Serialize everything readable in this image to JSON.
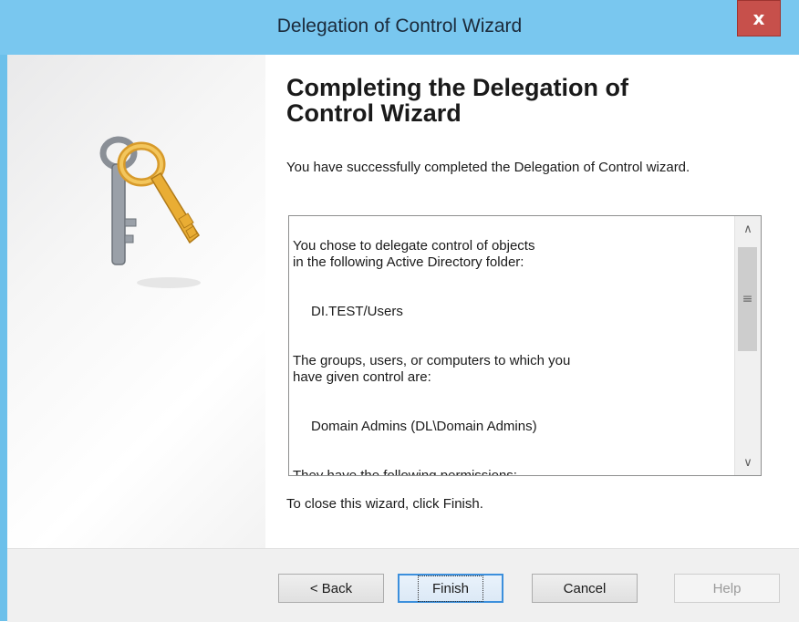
{
  "window": {
    "title": "Delegation of Control Wizard",
    "close_glyph": "x"
  },
  "content": {
    "heading": "Completing the Delegation of Control Wizard",
    "description": "You have successfully completed the Delegation of Control wizard.",
    "summary": {
      "line1": "You chose to delegate control of objects\nin the following Active Directory folder:",
      "folder": "DI.TEST/Users",
      "line2": "The groups, users, or computers to which you\nhave given control are:",
      "group": "Domain Admins (DL\\Domain Admins)",
      "line3": "They have the following permissions:"
    },
    "close_hint": "To close this wizard, click Finish."
  },
  "buttons": {
    "back": "< Back",
    "finish": "Finish",
    "cancel": "Cancel",
    "help": "Help"
  },
  "icons": {
    "wizard_art": "keys-icon",
    "scroll_up": "chevron-up-icon",
    "scroll_down": "chevron-down-icon",
    "scroll_thumb": "grip-icon"
  },
  "colors": {
    "titlebar": "#79c7ef",
    "close_button": "#c7504b",
    "default_button_border": "#3c8fdc"
  }
}
